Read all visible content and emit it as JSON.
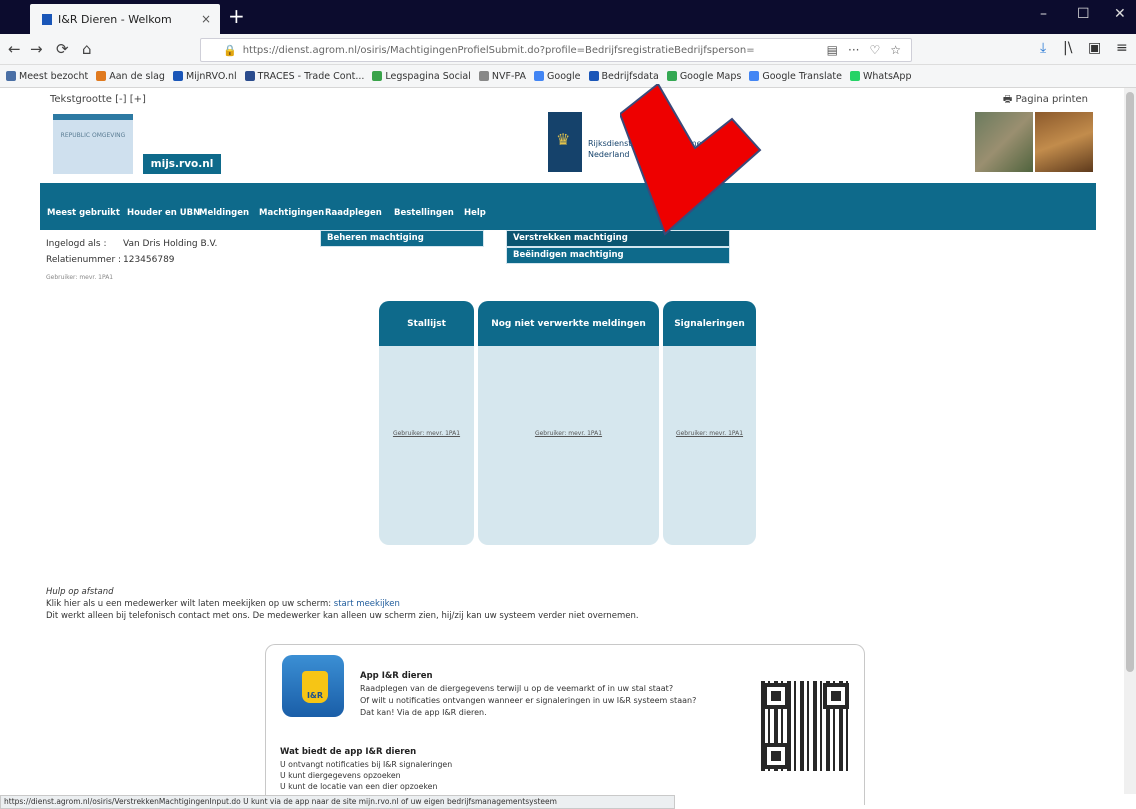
{
  "browser": {
    "tab_title": "I&R Dieren - Welkom",
    "tab_close": "×",
    "new_tab": "+",
    "url": "https://dienst.agrom.nl/osiris/MachtigingenProfielSubmit.do?profile=BedrijfsregistratieBedrijfsperson=",
    "window_controls": [
      "–",
      "☐",
      "✕"
    ],
    "nav": [
      "←",
      "→",
      "⟳",
      "⌂"
    ],
    "url_icons": [
      "▤",
      "···",
      "♡",
      "☆"
    ],
    "toolbar_icons": [
      "⤓",
      "|\\",
      "▣",
      "≡"
    ],
    "bookmarks": [
      {
        "label": "Meest bezocht",
        "color": "#4a6fa5"
      },
      {
        "label": "Aan de slag",
        "color": "#e07a1f"
      },
      {
        "label": "MijnRVO.nl",
        "color": "#1a56b8"
      },
      {
        "label": "TRACES - Trade Cont...",
        "color": "#2a4b8d"
      },
      {
        "label": "Legspagina Social",
        "color": "#3aa34a"
      },
      {
        "label": "NVF-PA",
        "color": "#888888"
      },
      {
        "label": "Google",
        "color": "#4285f4"
      },
      {
        "label": "Bedrijfsdata",
        "color": "#1a56b8"
      },
      {
        "label": "Google Maps",
        "color": "#34a853"
      },
      {
        "label": "Google Translate",
        "color": "#4285f4"
      },
      {
        "label": "WhatsApp",
        "color": "#25d366"
      }
    ],
    "status_url": "https://dienst.agrom.nl/osiris/VerstrekkenMachtigingenInput.do U kunt via de app naar de site mijn.rvo.nl of uw eigen bedrijfsmanagementsysteem"
  },
  "page": {
    "text_size": "Tekstgrootte",
    "print": "Pagina printen",
    "logo_left_text": "REPUBLIC OMGEVING",
    "mijs_label": "mijs.rvo.nl",
    "rijks_text": [
      "Rijksdienst voor Ondernemend",
      "Nederland"
    ]
  },
  "mainnav": {
    "items": [
      "Meest gebruikt",
      "Houder en UBN",
      "Meldingen",
      "Machtigingen",
      "Raadplegen",
      "Bestellingen",
      "Help"
    ],
    "submenu_machtigingen": "Beheren machtiging",
    "submenu_raadplegen": [
      "Verstrekken machtiging",
      "Beëindigen machtiging"
    ]
  },
  "info": {
    "logged_in_label": "Ingelogd als :",
    "logged_in_value": "Van Dris Holding B.V.",
    "relation_label": "Relatienummer :",
    "relation_value": "123456789",
    "small": "Gebruiker: mevr. 1PA1"
  },
  "cards": [
    {
      "title": "Stallijst",
      "link": "Gebruiker: mevr. 1PA1"
    },
    {
      "title": "Nog niet verwerkte meldingen",
      "link": "Gebruiker: mevr. 1PA1"
    },
    {
      "title": "Signaleringen",
      "link": "Gebruiker: mevr. 1PA1"
    }
  ],
  "help": {
    "title": "Hulp op afstand",
    "line1_prefix": "Klik hier als u een medewerker wilt laten meekijken op uw scherm:",
    "line1_link": "start meekijken",
    "line2": "Dit werkt alleen bij telefonisch contact met ons. De medewerker kan alleen uw scherm zien, hij/zij kan uw systeem verder niet overnemen."
  },
  "app": {
    "icon_text": "I&R",
    "title": "App I&R dieren",
    "lines": [
      "Raadplegen van de diergegevens terwijl u op de veemarkt of in uw stal staat?",
      "Of wilt u notificaties ontvangen wanneer er signaleringen in uw I&R systeem staan?",
      "Dat kan! Via de app I&R dieren."
    ],
    "what_title": "Wat biedt de app I&R dieren",
    "what_lines": [
      "U ontvangt notificaties bij I&R signaleringen",
      "U kunt diergegevens opzoeken",
      "U kunt de locatie van een dier opzoeken"
    ]
  }
}
